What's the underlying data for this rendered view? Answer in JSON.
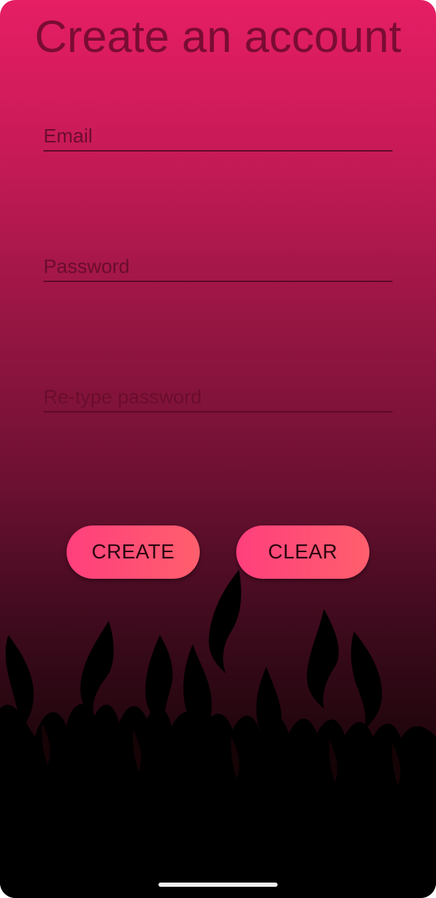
{
  "screen": {
    "title": "Create an account"
  },
  "form": {
    "email": {
      "value": "",
      "placeholder": "Email"
    },
    "password": {
      "value": "",
      "placeholder": "Password"
    },
    "retype_password": {
      "value": "",
      "placeholder": "Re-type password"
    }
  },
  "buttons": {
    "create_label": "CREATE",
    "clear_label": "CLEAR"
  },
  "colors": {
    "background_top": "#e61e64",
    "background_bottom": "#000000",
    "button_gradient_start": "#ff3f7d",
    "button_gradient_end": "#ff5f6d",
    "title_text": "#7a0c33"
  },
  "decoration": {
    "background_art": "flames-silhouette",
    "navigation": "home-indicator-bar"
  }
}
